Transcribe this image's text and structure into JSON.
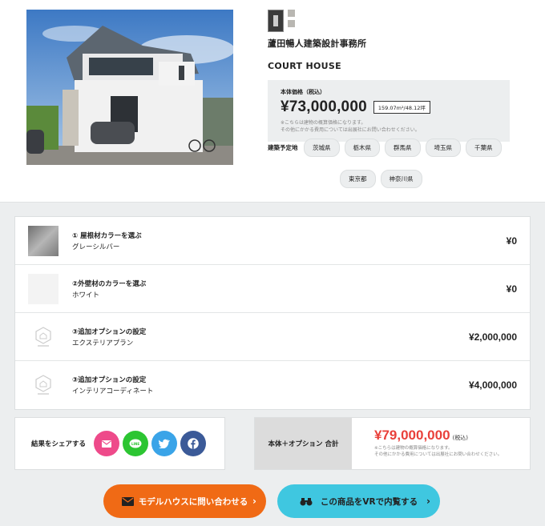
{
  "product": {
    "company": "蘆田暢人建築設計事務所",
    "house_name": "COURT HOUSE",
    "price_label": "本体価格（税込）",
    "price": "¥73,000,000",
    "size": "159.07m²/48.12坪",
    "note1": "※こちらは建物の概算価格になります。",
    "note2": "その他にかかる費用については出展社にお問い合わせください。",
    "location_label": "建築予定地",
    "locations": [
      "茨城県",
      "栃木県",
      "群馬県",
      "埼玉県",
      "千葉県",
      "東京都",
      "神奈川県"
    ]
  },
  "options": [
    {
      "title": "① 屋根材カラーを選ぶ",
      "value": "グレーシルバー",
      "price": "¥0",
      "thumb": "gray-swatch"
    },
    {
      "title": "②外壁材のカラーを選ぶ",
      "value": "ホワイト",
      "price": "¥0",
      "thumb": "white-swatch"
    },
    {
      "title": "③追加オプションの設定",
      "value": "エクステリアプラン",
      "price": "¥2,000,000",
      "thumb": "placeholder-logo"
    },
    {
      "title": "③追加オプションの設定",
      "value": "インテリアコーディネート",
      "price": "¥4,000,000",
      "thumb": "placeholder-logo"
    }
  ],
  "share": {
    "label": "結果をシェアする",
    "buttons": [
      {
        "name": "mail",
        "color": "#ee4a8a"
      },
      {
        "name": "line",
        "color": "#2cc532"
      },
      {
        "name": "twitter",
        "color": "#3aa4e8"
      },
      {
        "name": "facebook",
        "color": "#3b5a98"
      }
    ]
  },
  "total": {
    "label": "本体＋オプション 合計",
    "price": "¥79,000,000",
    "tax": "(税込)",
    "note1": "※こちらは建物の概算価格になります。",
    "note2": "その他にかかる費用については出展社にお問い合わせください。"
  },
  "cta": {
    "contact": "モデルハウスに問い合わせる",
    "vr": "この商品をVRで内覧する"
  },
  "colors": {
    "accent": "#e9403a",
    "contact": "#f06a15",
    "vr": "#3fc7e0"
  }
}
